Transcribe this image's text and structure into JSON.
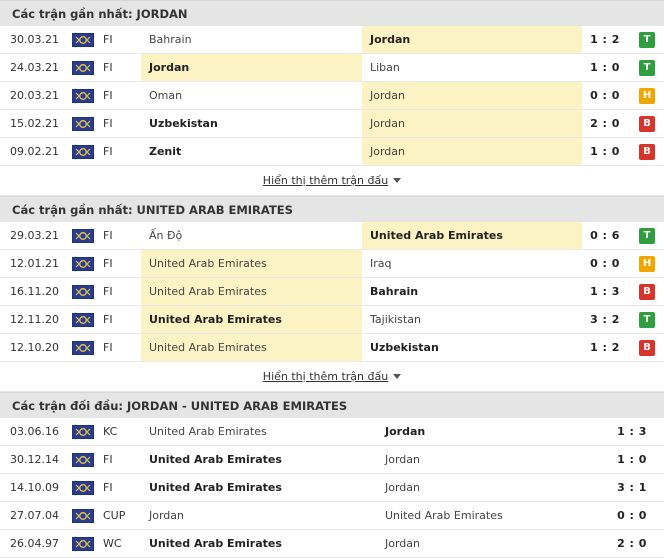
{
  "colors": {
    "win": "#2e9e3e",
    "draw": "#f0a500",
    "loss": "#d9342b",
    "highlight": "#fcf3c5",
    "header_bg": "#e5e5e5"
  },
  "icons": {
    "flag": "competition-flag-icon"
  },
  "sections": [
    {
      "title": "Các trận gần nhất: JORDAN",
      "show_more": "Hiển thị thêm trận đấu",
      "rows": [
        {
          "date": "30.03.21",
          "comp": "FI",
          "home": "Bahrain",
          "away": "Jordan",
          "score": "1 : 2",
          "result": "T",
          "hl": "away",
          "bold": "away"
        },
        {
          "date": "24.03.21",
          "comp": "FI",
          "home": "Jordan",
          "away": "Liban",
          "score": "1 : 0",
          "result": "T",
          "hl": "home",
          "bold": "home"
        },
        {
          "date": "20.03.21",
          "comp": "FI",
          "home": "Oman",
          "away": "Jordan",
          "score": "0 : 0",
          "result": "H",
          "hl": "away",
          "bold": "none"
        },
        {
          "date": "15.02.21",
          "comp": "FI",
          "home": "Uzbekistan",
          "away": "Jordan",
          "score": "2 : 0",
          "result": "B",
          "hl": "away",
          "bold": "home"
        },
        {
          "date": "09.02.21",
          "comp": "FI",
          "home": "Zenit",
          "away": "Jordan",
          "score": "1 : 0",
          "result": "B",
          "hl": "away",
          "bold": "home"
        }
      ]
    },
    {
      "title": "Các trận gần nhất: UNITED ARAB EMIRATES",
      "show_more": "Hiển thị thêm trận đấu",
      "rows": [
        {
          "date": "29.03.21",
          "comp": "FI",
          "home": "Ấn Độ",
          "away": "United Arab Emirates",
          "score": "0 : 6",
          "result": "T",
          "hl": "away",
          "bold": "away"
        },
        {
          "date": "12.01.21",
          "comp": "FI",
          "home": "United Arab Emirates",
          "away": "Iraq",
          "score": "0 : 0",
          "result": "H",
          "hl": "home",
          "bold": "none"
        },
        {
          "date": "16.11.20",
          "comp": "FI",
          "home": "United Arab Emirates",
          "away": "Bahrain",
          "score": "1 : 3",
          "result": "B",
          "hl": "home",
          "bold": "away"
        },
        {
          "date": "12.11.20",
          "comp": "FI",
          "home": "United Arab Emirates",
          "away": "Tajikistan",
          "score": "3 : 2",
          "result": "T",
          "hl": "home",
          "bold": "home"
        },
        {
          "date": "12.10.20",
          "comp": "FI",
          "home": "United Arab Emirates",
          "away": "Uzbekistan",
          "score": "1 : 2",
          "result": "B",
          "hl": "home",
          "bold": "away"
        }
      ]
    },
    {
      "title": "Các trận đối đầu: JORDAN - UNITED ARAB EMIRATES",
      "rows": [
        {
          "date": "03.06.16",
          "comp": "KC",
          "home": "United Arab Emirates",
          "away": "Jordan",
          "score": "1 : 3",
          "bold": "away"
        },
        {
          "date": "30.12.14",
          "comp": "FI",
          "home": "United Arab Emirates",
          "away": "Jordan",
          "score": "1 : 0",
          "bold": "home"
        },
        {
          "date": "14.10.09",
          "comp": "FI",
          "home": "United Arab Emirates",
          "away": "Jordan",
          "score": "3 : 1",
          "bold": "home"
        },
        {
          "date": "27.07.04",
          "comp": "CUP",
          "home": "Jordan",
          "away": "United Arab Emirates",
          "score": "0 : 0",
          "bold": "none"
        },
        {
          "date": "26.04.97",
          "comp": "WC",
          "home": "United Arab Emirates",
          "away": "Jordan",
          "score": "2 : 0",
          "bold": "home"
        }
      ]
    }
  ]
}
